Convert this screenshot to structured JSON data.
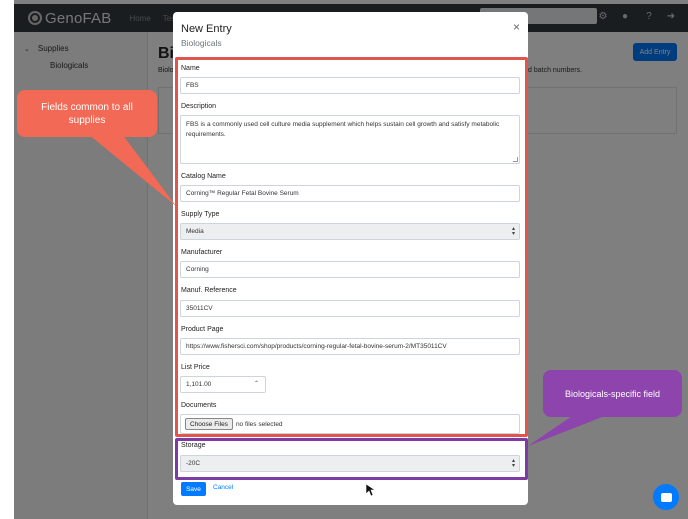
{
  "navbar": {
    "brand": "GenoFAB",
    "links": [
      "Home",
      "Tes"
    ],
    "icons": [
      "gear-icon",
      "user-icon",
      "help-icon",
      "sign-out-icon"
    ]
  },
  "sidebar": {
    "group_label": "Supplies",
    "items": [
      {
        "label": "Biologicals"
      }
    ]
  },
  "main": {
    "title": "Bio",
    "desc_left": "Biolo",
    "desc_right": "d batch numbers.",
    "add_entry_label": "Add Entry"
  },
  "modal": {
    "title": "New Entry",
    "subtitle": "Biologicals",
    "close_symbol": "×",
    "fields": {
      "name": {
        "label": "Name",
        "value": "FBS"
      },
      "description": {
        "label": "Description",
        "value": "FBS is a commonly used cell culture media supplement which helps sustain cell growth and satisfy metabolic requirements."
      },
      "catalog_name": {
        "label": "Catalog Name",
        "value": "Corning™ Regular Fetal Bovine Serum"
      },
      "supply_type": {
        "label": "Supply Type",
        "value": "Media"
      },
      "manufacturer": {
        "label": "Manufacturer",
        "value": "Corning"
      },
      "manuf_reference": {
        "label": "Manuf. Reference",
        "value": "35011CV"
      },
      "product_page": {
        "label": "Product Page",
        "value": "https://www.fishersci.com/shop/products/corning-regular-fetal-bovine-serum-2/MT35011CV"
      },
      "list_price": {
        "label": "List Price",
        "value": "1,101.00"
      },
      "documents": {
        "label": "Documents",
        "button_label": "Choose Files",
        "status": "no files selected"
      },
      "storage": {
        "label": "Storage",
        "value": "-20C"
      }
    },
    "save_label": "Save",
    "cancel_label": "Cancel"
  },
  "annotations": {
    "common_fields": "Fields common to all supplies",
    "specific_field": "Biologicals-specific field",
    "common_color": "#e0564c",
    "specific_color": "#7d3ba5"
  }
}
